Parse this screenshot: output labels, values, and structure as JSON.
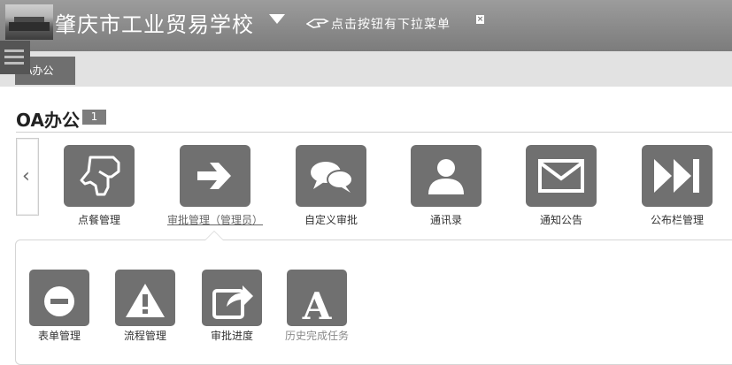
{
  "header": {
    "school_name": "肇庆市工业贸易学校",
    "hint": "点击按钮有下拉菜单",
    "close": "×"
  },
  "tabs": [
    {
      "label": "OA办公"
    }
  ],
  "page": {
    "title": "OA办公",
    "badge": "1"
  },
  "carousel": {
    "prev": "‹",
    "items": [
      {
        "label": "点餐管理",
        "icon": "pointing-hand-icon"
      },
      {
        "label": "审批管理（管理员）",
        "icon": "arrow-right-icon"
      },
      {
        "label": "自定义审批",
        "icon": "chat-bubbles-icon"
      },
      {
        "label": "通讯录",
        "icon": "user-icon"
      },
      {
        "label": "通知公告",
        "icon": "envelope-icon"
      },
      {
        "label": "公布栏管理",
        "icon": "fast-forward-icon"
      }
    ]
  },
  "submenu": {
    "items": [
      {
        "label": "表单管理",
        "icon": "minus-circle-icon"
      },
      {
        "label": "流程管理",
        "icon": "warning-icon"
      },
      {
        "label": "审批进度",
        "icon": "share-icon"
      },
      {
        "label": "历史完成任务",
        "icon": "letter-a-icon"
      }
    ]
  }
}
